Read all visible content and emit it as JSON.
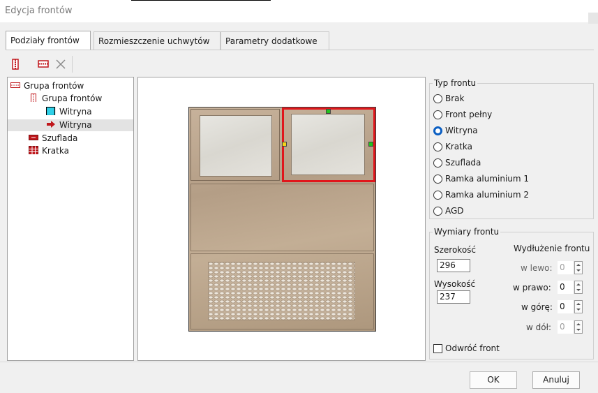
{
  "window": {
    "title": "Edycja frontów"
  },
  "tabs": [
    {
      "label": "Podziały frontów",
      "active": true
    },
    {
      "label": "Rozmieszczenie uchwytów",
      "active": false
    },
    {
      "label": "Parametry dodatkowe",
      "active": false
    }
  ],
  "toolbar": {
    "icons": [
      "vertical-split-icon",
      "horizontal-split-icon",
      "delete-icon"
    ]
  },
  "tree": {
    "items": [
      {
        "label": "Grupa frontów",
        "icon": "horizontal-group-icon",
        "level": 0
      },
      {
        "label": "Grupa frontów",
        "icon": "vertical-group-icon",
        "level": 1
      },
      {
        "label": "Witryna",
        "icon": "cyan-square-icon",
        "level": 2
      },
      {
        "label": "Witryna",
        "icon": "red-arrow-icon",
        "level": 2,
        "selected": true
      },
      {
        "label": "Szuflada",
        "icon": "drawer-icon",
        "level": 1
      },
      {
        "label": "Kratka",
        "icon": "grid-icon",
        "level": 1
      }
    ]
  },
  "typ_frontu": {
    "title": "Typ frontu",
    "options": [
      "Brak",
      "Front pełny",
      "Witryna",
      "Kratka",
      "Szuflada",
      "Ramka aluminium 1",
      "Ramka aluminium 2",
      "AGD"
    ],
    "selected": "Witryna"
  },
  "wymiary": {
    "title": "Wymiary frontu",
    "szerokosc_label": "Szerokość",
    "szerokosc_value": "296",
    "wysokosc_label": "Wysokość",
    "wysokosc_value": "237",
    "wydluzenie_label": "Wydłużenie frontu",
    "w_lewo_label": "w lewo:",
    "w_lewo_value": "0",
    "w_prawo_label": "w prawo:",
    "w_prawo_value": "0",
    "w_gore_label": "w górę:",
    "w_gore_value": "0",
    "w_dol_label": "w dół:",
    "w_dol_value": "0"
  },
  "odwroc_label": "Odwróć front",
  "buttons": {
    "ok": "OK",
    "cancel": "Anuluj"
  },
  "colors": {
    "selection_red": "#e0161b",
    "radio_blue": "#0a5ec2",
    "handle_green": "#22c21e",
    "handle_yellow": "#f4d21a"
  }
}
